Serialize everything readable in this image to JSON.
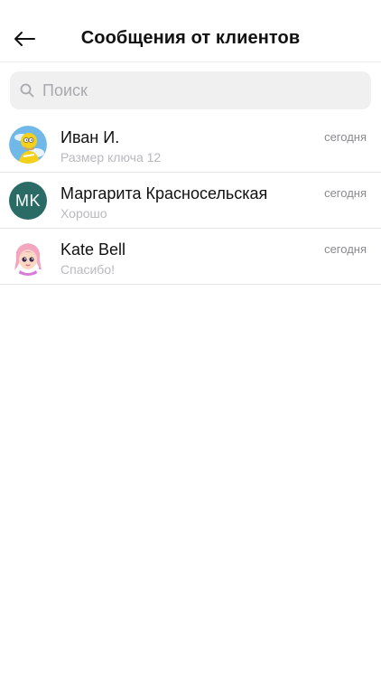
{
  "header": {
    "title": "Сообщения от клиентов",
    "back_icon": "arrow-left-icon"
  },
  "search": {
    "placeholder": "Поиск",
    "value": "",
    "icon": "search-icon"
  },
  "conversations": [
    {
      "name": "Иван И.",
      "preview": "Размер ключа 12",
      "time": "сегодня",
      "avatar": "cartoon-character-avatar"
    },
    {
      "name": "Маргарита Красносельская",
      "preview": "Хорошо",
      "time": "сегодня",
      "avatar_initials": "MK",
      "avatar_color": "#2a6b66"
    },
    {
      "name": "Kate Bell",
      "preview": "Спасибо!",
      "time": "сегодня",
      "avatar": "cartoon-girl-avatar"
    }
  ],
  "colors": {
    "accent_avatar": "#2a6b66",
    "search_bg": "#f0f0f1",
    "divider": "#e5e5e5"
  }
}
